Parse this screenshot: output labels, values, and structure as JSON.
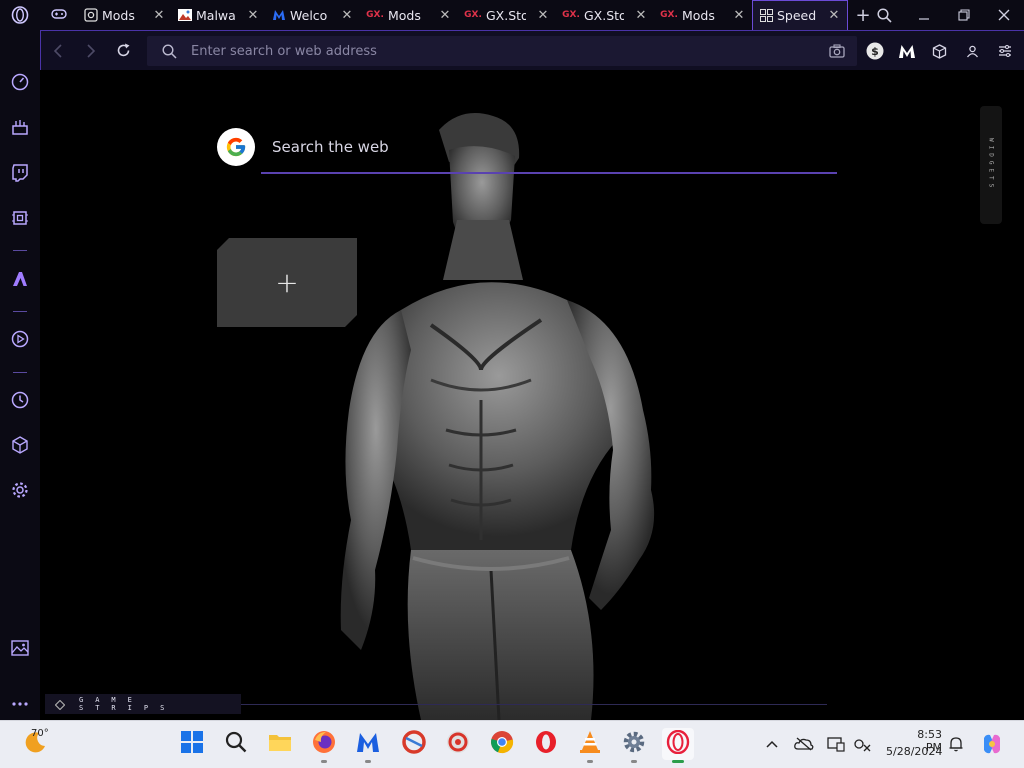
{
  "tabs": [
    {
      "label": "Mods",
      "favicon": "gear-box"
    },
    {
      "label": "Malwa",
      "favicon": "image-thumb"
    },
    {
      "label": "Welco",
      "favicon": "malwarebytes-m"
    },
    {
      "label": "Mods",
      "favicon": "gx"
    },
    {
      "label": "GX.Sto",
      "favicon": "gx"
    },
    {
      "label": "GX.Sto",
      "favicon": "gx"
    },
    {
      "label": "Mods",
      "favicon": "gx"
    },
    {
      "label": "Speed",
      "favicon": "speed-dial-grid",
      "active": true
    }
  ],
  "address_bar": {
    "placeholder": "Enter search or web address"
  },
  "content": {
    "search_placeholder": "Search the web",
    "add_tile_symbol": "+",
    "widgets_label": "WIDGETS",
    "game_strips_label": "GAME STRIPS"
  },
  "taskbar": {
    "weather_temp": "70°",
    "time": "8:53 PM",
    "date": "5/28/2024"
  },
  "colors": {
    "accent": "#6b4bd6",
    "chrome_bg": "#0b0a14",
    "gx_red": "#e0324a"
  }
}
